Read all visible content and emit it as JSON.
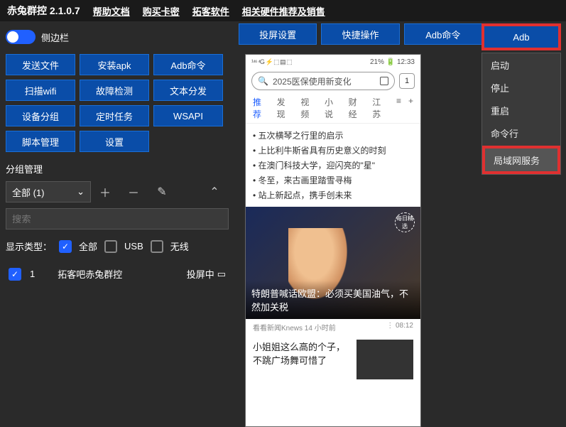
{
  "topbar": {
    "title": "赤兔群控 2.1.0.7",
    "links": [
      "帮助文档",
      "购买卡密",
      "拓客软件",
      "相关硬件推荐及销售"
    ]
  },
  "sidebar_toggle_label": "侧边栏",
  "left_buttons": [
    "发送文件",
    "安装apk",
    "Adb命令",
    "扫描wifi",
    "故障检测",
    "文本分发",
    "设备分组",
    "定时任务",
    "WSAPI",
    "脚本管理",
    "设置"
  ],
  "group_section_label": "分组管理",
  "group_select_label": "全部 (1)",
  "search_placeholder": "搜索",
  "display_type_label": "显示类型：",
  "filters": {
    "all": "全部",
    "usb": "USB",
    "wireless": "无线"
  },
  "device": {
    "index": "1",
    "name": "拓客吧赤兔群控",
    "status": "投屏中"
  },
  "tabs": [
    "投屏设置",
    "快捷操作",
    "Adb命令",
    "Adb"
  ],
  "dropdown": {
    "items": [
      "启动",
      "停止",
      "重启",
      "命令行"
    ],
    "highlight": "局域网服务"
  },
  "phone": {
    "status_left": "¹⁴⁶ ⁴G ⚡ ⬚ ▤ ⬚",
    "status_battery": "21%",
    "status_time": "12:33",
    "search_text": "2025医保使用新变化",
    "badge": "1",
    "nav": [
      "推荐",
      "发现",
      "视频",
      "小说",
      "财经",
      "江苏"
    ],
    "nav_extra_1": "≡",
    "nav_extra_2": "+",
    "headlines": [
      "• 五次横琴之行里的启示",
      "• 上比利牛斯省具有历史意义的时刻",
      "• 在澳门科技大学，迎闪亮的\"星\"",
      "• 冬至，来古画里踏雪寻梅",
      "• 站上新起点，携手创未来"
    ],
    "stamp": "每日精选",
    "caption": "特朗普喊话欧盟：必须买美国油气，不然加关税",
    "meta_left": "看看新闻Knews  14 小时前",
    "meta_right": "⋮ 08:12",
    "second_title": "小姐姐这么高的个子，不跳广场舞可惜了"
  }
}
